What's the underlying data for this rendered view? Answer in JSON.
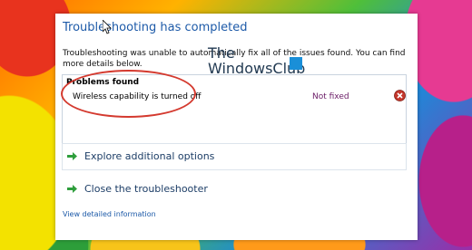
{
  "dialog": {
    "title": "Troubleshooting has completed",
    "description": "Troubleshooting was unable to automatically fix all of the issues found. You can find more details below."
  },
  "problems": {
    "header": "Problems found",
    "items": [
      {
        "name": "Wireless capability is turned off",
        "status": "Not fixed"
      }
    ]
  },
  "options": [
    {
      "label": "Explore additional options"
    },
    {
      "label": "Close the troubleshooter"
    }
  ],
  "link": {
    "label": "View detailed information"
  },
  "watermark": {
    "line1": "The",
    "line2": "WindowsClub"
  },
  "colors": {
    "title": "#1d5aa8",
    "status_not_fixed": "#6a1b66",
    "annotation_circle": "#d43a2f",
    "error_icon": "#c4372c",
    "arrow_icon": "#2e9e3c"
  },
  "icons": {
    "error": "error-x-icon",
    "arrow": "green-arrow-icon"
  }
}
